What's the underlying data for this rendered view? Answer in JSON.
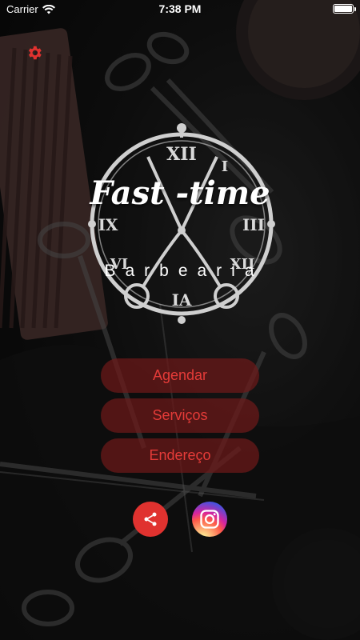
{
  "status_bar": {
    "carrier": "Carrier",
    "time": "7:38 PM"
  },
  "logo": {
    "title": "Fast -time",
    "subtitle": "Barbearia",
    "numerals": [
      "XII",
      "I",
      "III",
      "IX",
      "VI",
      "IA"
    ]
  },
  "menu": {
    "agendar": "Agendar",
    "servicos": "Serviços",
    "endereco": "Endereço"
  },
  "colors": {
    "accent": "#e0322f",
    "button_bg": "#6e1919",
    "button_text": "#e53b38"
  },
  "icons": {
    "settings": "gear-icon",
    "share": "share-icon",
    "instagram": "instagram-icon"
  }
}
